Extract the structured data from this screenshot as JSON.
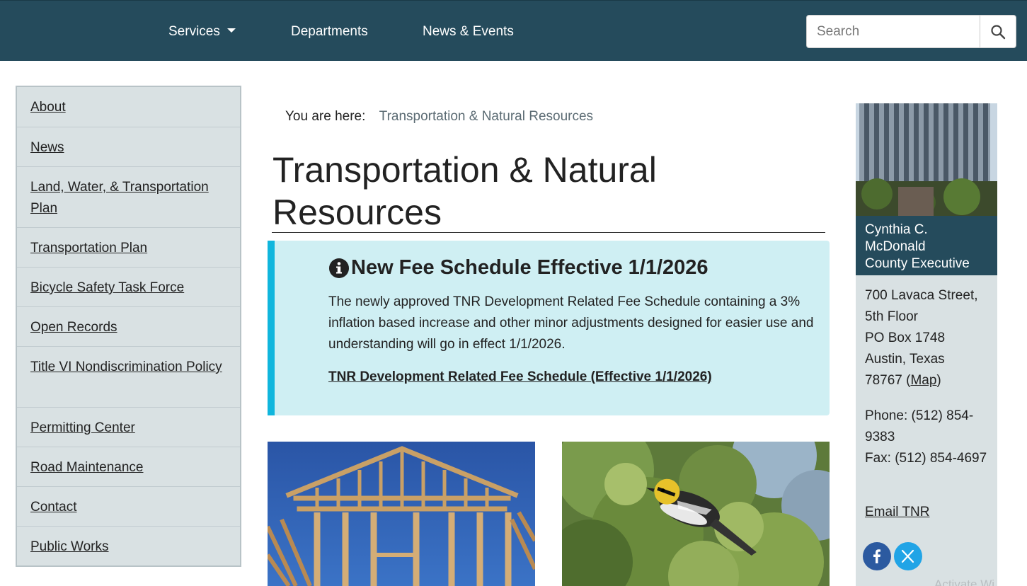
{
  "nav": {
    "services": "Services",
    "departments": "Departments",
    "news_events": "News & Events",
    "search_placeholder": "Search"
  },
  "sidebar": {
    "items": [
      {
        "label": "About"
      },
      {
        "label": "News"
      },
      {
        "label": "Land, Water, & Transportation Plan"
      },
      {
        "label": "Transportation Plan"
      },
      {
        "label": "Bicycle Safety Task Force"
      },
      {
        "label": "Open Records"
      },
      {
        "label": "Title VI Nondiscrimination Policy"
      },
      {
        "label": "Permitting Center"
      },
      {
        "label": "Road Maintenance"
      },
      {
        "label": "Contact"
      },
      {
        "label": "Public Works"
      }
    ]
  },
  "breadcrumb": {
    "prefix": "You are here:",
    "current": "Transportation & Natural Resources"
  },
  "page": {
    "title": "Transportation & Natural Resources"
  },
  "alert": {
    "heading": "New Fee Schedule Effective 1/1/2026",
    "body": "The newly approved TNR Development Related Fee Schedule containing a 3% inflation based increase and other minor adjustments designed for easier use and understanding will go in effect 1/1/2026.",
    "link": "TNR Development Related Fee Schedule (Effective 1/1/2026)",
    "icon": "info-icon"
  },
  "executive": {
    "name": "Cynthia C. McDonald",
    "role": "County Executive"
  },
  "contact": {
    "street": "700 Lavaca Street, 5th Floor",
    "po_box": "PO Box 1748",
    "city": "Austin, Texas",
    "zip": "78767",
    "map_label": "Map",
    "phone": "Phone: (512) 854-9383",
    "fax": "Fax: (512) 854-4697",
    "email_label": "Email TNR"
  },
  "colors": {
    "header_bg": "#254b5c",
    "sidebar_bg": "#d9e1e3",
    "alert_bg": "#cfeff3",
    "alert_accent": "#10b6dd"
  },
  "watermark": "Activate Wi"
}
